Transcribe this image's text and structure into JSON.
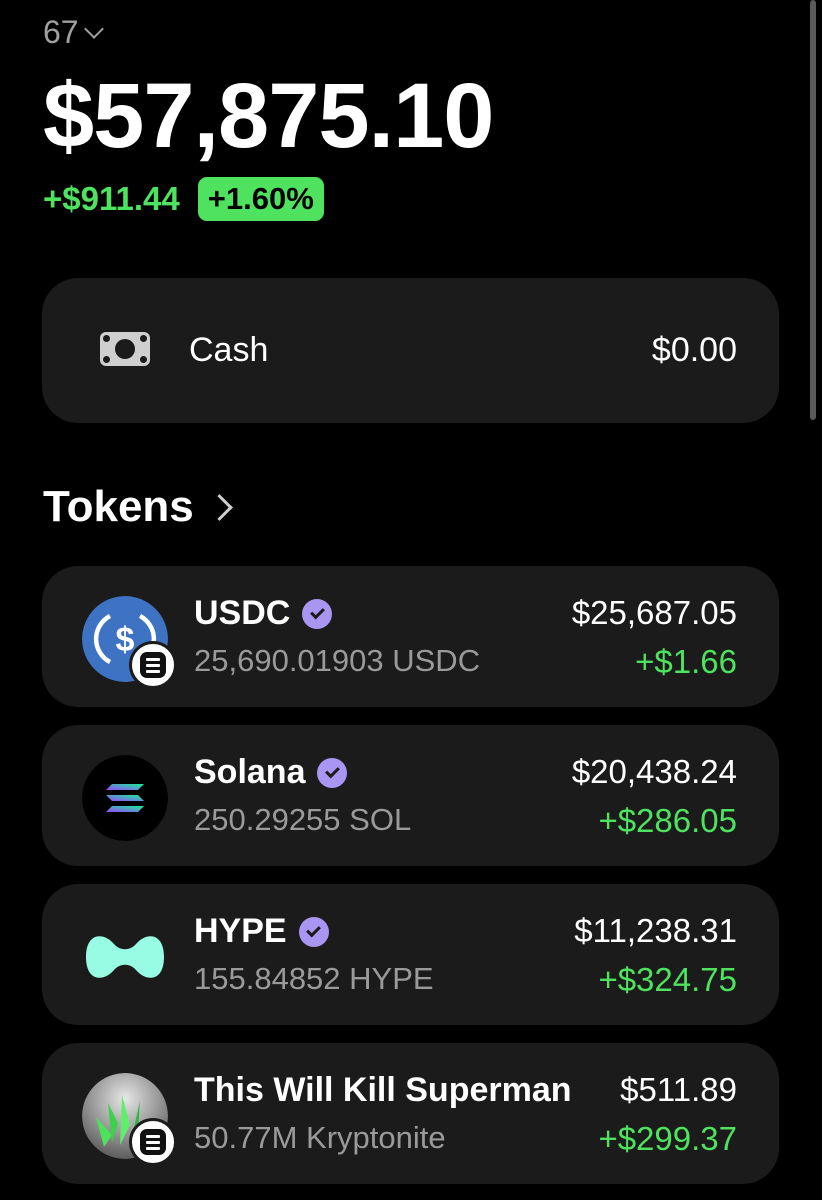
{
  "account": {
    "label": "67"
  },
  "portfolio": {
    "balance": "$57,875.10",
    "change_amount": "+$911.44",
    "change_percent": "+1.60%"
  },
  "cash": {
    "label": "Cash",
    "value": "$0.00",
    "icon": "cash-icon"
  },
  "tokens": {
    "title": "Tokens",
    "items": [
      {
        "name": "USDC",
        "amount": "25,690.01903 USDC",
        "value": "$25,687.05",
        "gain": "+$1.66",
        "icon": "usdc-logo-icon"
      },
      {
        "name": "Solana",
        "amount": "250.29255 SOL",
        "value": "$20,438.24",
        "gain": "+$286.05",
        "icon": "solana-logo-icon"
      },
      {
        "name": "HYPE",
        "amount": "155.84852 HYPE",
        "value": "$11,238.31",
        "gain": "+$324.75",
        "icon": "hype-logo-icon"
      },
      {
        "name": "This Will Kill Superman",
        "amount": "50.77M Kryptonite",
        "value": "$511.89",
        "gain": "+$299.37",
        "icon": "kryptonite-logo-icon"
      }
    ]
  },
  "colors": {
    "background": "#000000",
    "card": "#1b1b1b",
    "positive": "#4ee25e",
    "verified": "#a996f3",
    "usdc": "#3e73c4",
    "hype": "#98fce4"
  }
}
